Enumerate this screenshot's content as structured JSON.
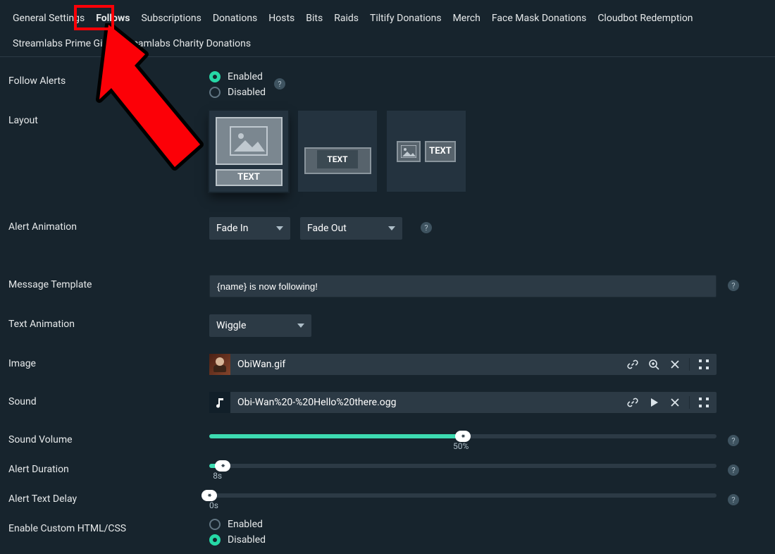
{
  "tabs": [
    "General Settings",
    "Follows",
    "Subscriptions",
    "Donations",
    "Hosts",
    "Bits",
    "Raids",
    "Tiltify Donations",
    "Merch",
    "Face Mask Donations",
    "Cloudbot Redemption",
    "Streamlabs Prime Gift",
    "Streamlabs Charity Donations"
  ],
  "active_tab_index": 1,
  "follow_alerts": {
    "label": "Follow Alerts",
    "enabled_label": "Enabled",
    "disabled_label": "Disabled",
    "value": "enabled"
  },
  "layout": {
    "label": "Layout",
    "tile_text": "TEXT",
    "selected": 0
  },
  "alert_animation": {
    "label": "Alert Animation",
    "in_value": "Fade In",
    "out_value": "Fade Out"
  },
  "message_template": {
    "label": "Message Template",
    "value": "{name} is now following!"
  },
  "text_animation": {
    "label": "Text Animation",
    "value": "Wiggle"
  },
  "image": {
    "label": "Image",
    "filename": "ObiWan.gif"
  },
  "sound": {
    "label": "Sound",
    "filename": "Obi-Wan%20-%20Hello%20there.ogg"
  },
  "sound_volume": {
    "label": "Sound Volume",
    "percent": 50,
    "display": "50%"
  },
  "alert_duration": {
    "label": "Alert Duration",
    "seconds": 8,
    "display": "8s",
    "max_seconds": 300
  },
  "alert_text_delay": {
    "label": "Alert Text Delay",
    "seconds": 0,
    "display": "0s",
    "max_seconds": 300
  },
  "custom_html": {
    "label": "Enable Custom HTML/CSS",
    "enabled_label": "Enabled",
    "disabled_label": "Disabled",
    "value": "disabled"
  },
  "icons": {
    "help": "?",
    "link": "link-icon",
    "zoom": "zoom-icon",
    "play": "play-icon",
    "remove": "close-icon",
    "grip": "grip-icon",
    "music": "music-icon"
  }
}
